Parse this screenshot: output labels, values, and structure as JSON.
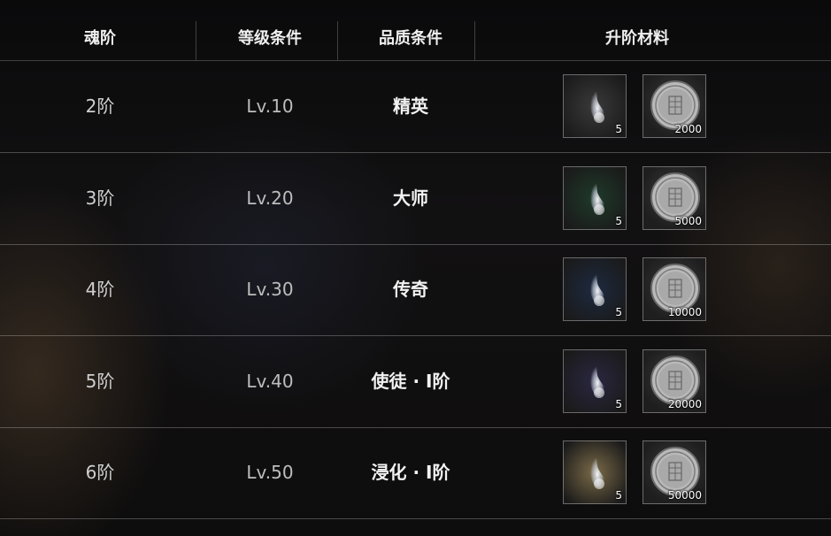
{
  "header": {
    "rank": "魂阶",
    "level": "等级条件",
    "quality": "品质条件",
    "materials": "升阶材料"
  },
  "rows": [
    {
      "rank": "2阶",
      "level": "Lv.10",
      "quality": "精英",
      "soul_qty": "5",
      "coin_qty": "2000",
      "soul_bg": "#3a3a3a"
    },
    {
      "rank": "3阶",
      "level": "Lv.20",
      "quality": "大师",
      "soul_qty": "5",
      "coin_qty": "5000",
      "soul_bg": "#1f3a2a"
    },
    {
      "rank": "4阶",
      "level": "Lv.30",
      "quality": "传奇",
      "soul_qty": "5",
      "coin_qty": "10000",
      "soul_bg": "#1d2a40"
    },
    {
      "rank": "5阶",
      "level": "Lv.40",
      "quality": "使徒 · Ⅰ阶",
      "soul_qty": "5",
      "coin_qty": "20000",
      "soul_bg": "#2a2740"
    },
    {
      "rank": "6阶",
      "level": "Lv.50",
      "quality": "浸化 · Ⅰ阶",
      "soul_qty": "5",
      "coin_qty": "50000",
      "soul_bg": "#7a6a48"
    }
  ],
  "icons": {
    "soul": "soul-wisp-icon",
    "coin": "silver-coin-icon"
  }
}
